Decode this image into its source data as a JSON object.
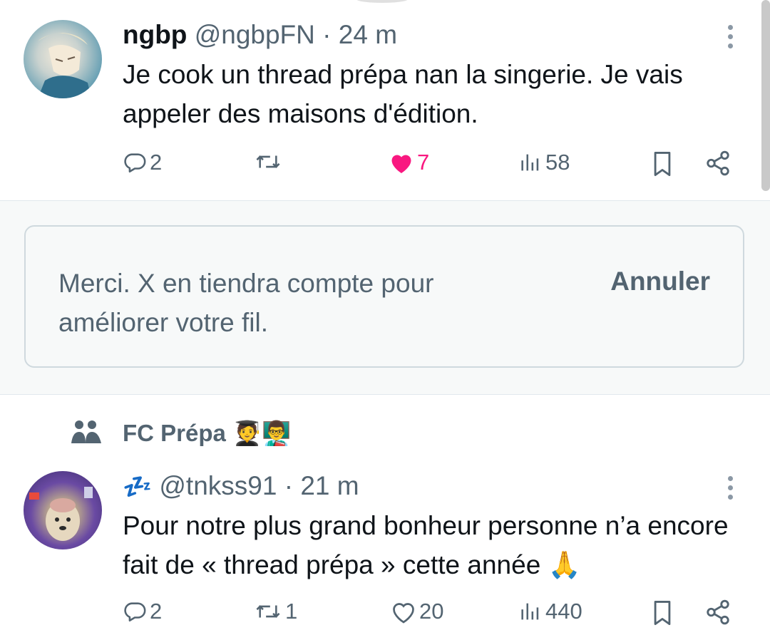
{
  "tweets": [
    {
      "display_name": "ngbp",
      "handle": "@ngbpFN",
      "separator": "·",
      "time": "24 m",
      "text": "Je cook un thread prépa nan la singerie. Je vais appeler des maisons d'édition.",
      "replies": "2",
      "retweets": "",
      "likes": "7",
      "liked": true,
      "views": "58"
    },
    {
      "display_name": "💤",
      "handle": "@tnkss91",
      "separator": "·",
      "time": "21 m",
      "text": "Pour notre plus grand bonheur personne n’a encore fait de « thread prépa » cette année 🙏",
      "replies": "2",
      "retweets": "1",
      "likes": "20",
      "liked": false,
      "views": "440"
    }
  ],
  "feedback": {
    "message": "Merci. X en tiendra compte pour améliorer votre fil.",
    "undo_label": "Annuler"
  },
  "community": {
    "name": "FC Prépa",
    "emojis": "🧑‍🎓👨‍🏫"
  },
  "colors": {
    "text": "#0f1419",
    "muted": "#536471",
    "like": "#f91880",
    "feedback_bg": "#f7f9f9",
    "border": "#cfd9de"
  },
  "icons": [
    "reply-icon",
    "retweet-icon",
    "like-icon",
    "views-icon",
    "bookmark-icon",
    "share-icon",
    "more-icon",
    "community-icon"
  ]
}
